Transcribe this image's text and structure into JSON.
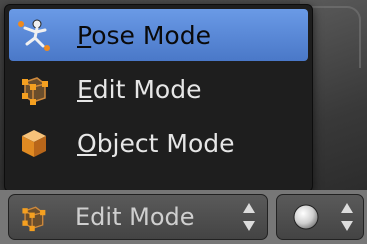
{
  "menu": {
    "items": [
      {
        "label": "Pose Mode",
        "icon": "pose-mode-icon",
        "active": true
      },
      {
        "label": "Edit Mode",
        "icon": "edit-mode-icon",
        "active": false
      },
      {
        "label": "Object Mode",
        "icon": "object-mode-icon",
        "active": false
      }
    ],
    "highlight_color": "#5a88d8"
  },
  "header": {
    "mode_select": {
      "value": "Edit Mode",
      "icon": "edit-mode-icon"
    },
    "shading_select": {
      "icon": "solid-sphere-icon"
    }
  }
}
